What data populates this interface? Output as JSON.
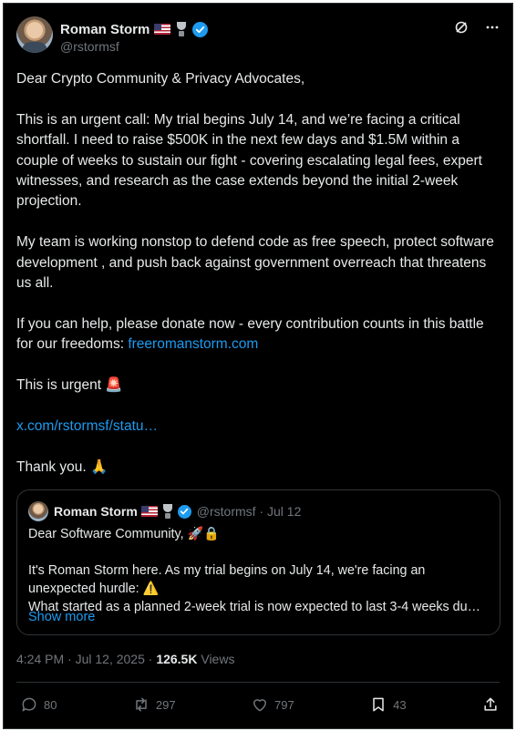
{
  "author": {
    "name": "Roman Storm",
    "handle": "@rstormsf"
  },
  "header_icons": [
    "grok-icon",
    "more-icon"
  ],
  "post": {
    "paragraphs": [
      "Dear Crypto Community & Privacy Advocates,",
      "This is an urgent call: My trial begins July 14, and we’re facing a critical shortfall. I need to raise $500K in the next few days and $1.5M within a couple of weeks to sustain our fight - covering escalating legal fees, expert witnesses, and research as the case extends beyond the initial 2-week projection.",
      "My team is working nonstop to defend code as free speech, protect software development , and push back against government overreach that threatens us all."
    ],
    "donate_text": "If you can help, please donate now - every contribution counts in this battle for our freedoms: ",
    "donate_link": "freeromanstorm.com",
    "urgent_text": "This is urgent ",
    "urgent_emoji": "🚨",
    "status_link": "x.com/rstormsf/statu…",
    "thanks_text": "Thank you. ",
    "thanks_emoji": "🙏"
  },
  "quoted": {
    "name": "Roman Storm",
    "handle_date": "@rstormsf · Jul 12",
    "line1": "Dear Software Community, 🚀🔒",
    "line2": "It's Roman Storm here. As my trial begins on July 14, we're facing an",
    "line3": "unexpected hurdle: ⚠️",
    "line4": "What started as a planned 2-week trial is now expected to last 3-4 weeks du…",
    "show_more": "Show more"
  },
  "meta": {
    "time": "4:24 PM · Jul 12, 2025 · ",
    "views_count": "126.5K",
    "views_label": " Views"
  },
  "actions": {
    "replies": "80",
    "reposts": "297",
    "likes": "797",
    "bookmarks": "43"
  },
  "colors": {
    "background": "#000000",
    "text": "#e7e9ea",
    "muted": "#71767b",
    "link": "#1d9bf0",
    "border": "#2f3336"
  }
}
